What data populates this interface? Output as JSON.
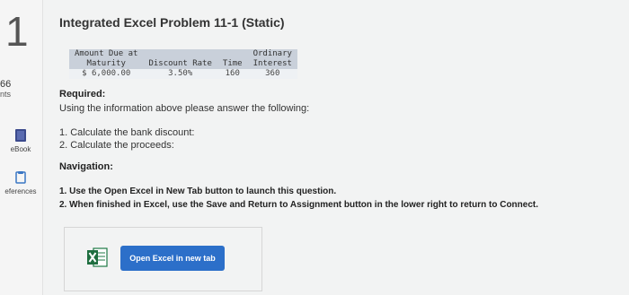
{
  "sidebar": {
    "question_number": "1",
    "points_value": "66",
    "points_label": "nts",
    "ebook_label": "eBook",
    "references_label": "eferences"
  },
  "main": {
    "title": "Integrated Excel Problem 11-1 (Static)",
    "table": {
      "headers": {
        "amount_line1": "Amount Due at",
        "amount_line2": "Maturity",
        "discount_rate": "Discount Rate",
        "time": "Time",
        "ordinary_line1": "Ordinary",
        "ordinary_line2": "Interest"
      },
      "values": {
        "amount": "$ 6,000.00",
        "discount_rate": "3.50%",
        "time": "160",
        "ordinary_interest": "360"
      }
    },
    "required_title": "Required:",
    "required_text": "Using the information above please answer the following:",
    "questions": [
      "1. Calculate the bank discount:",
      "2. Calculate the proceeds:"
    ],
    "navigation_title": "Navigation:",
    "navigation_steps": [
      "1. Use the Open Excel in New Tab button to launch this question.",
      "2. When finished in Excel, use the Save and Return to Assignment button in the lower right to return to Connect."
    ],
    "excel_icon": "excel-icon",
    "open_button_label": "Open Excel in new tab"
  }
}
